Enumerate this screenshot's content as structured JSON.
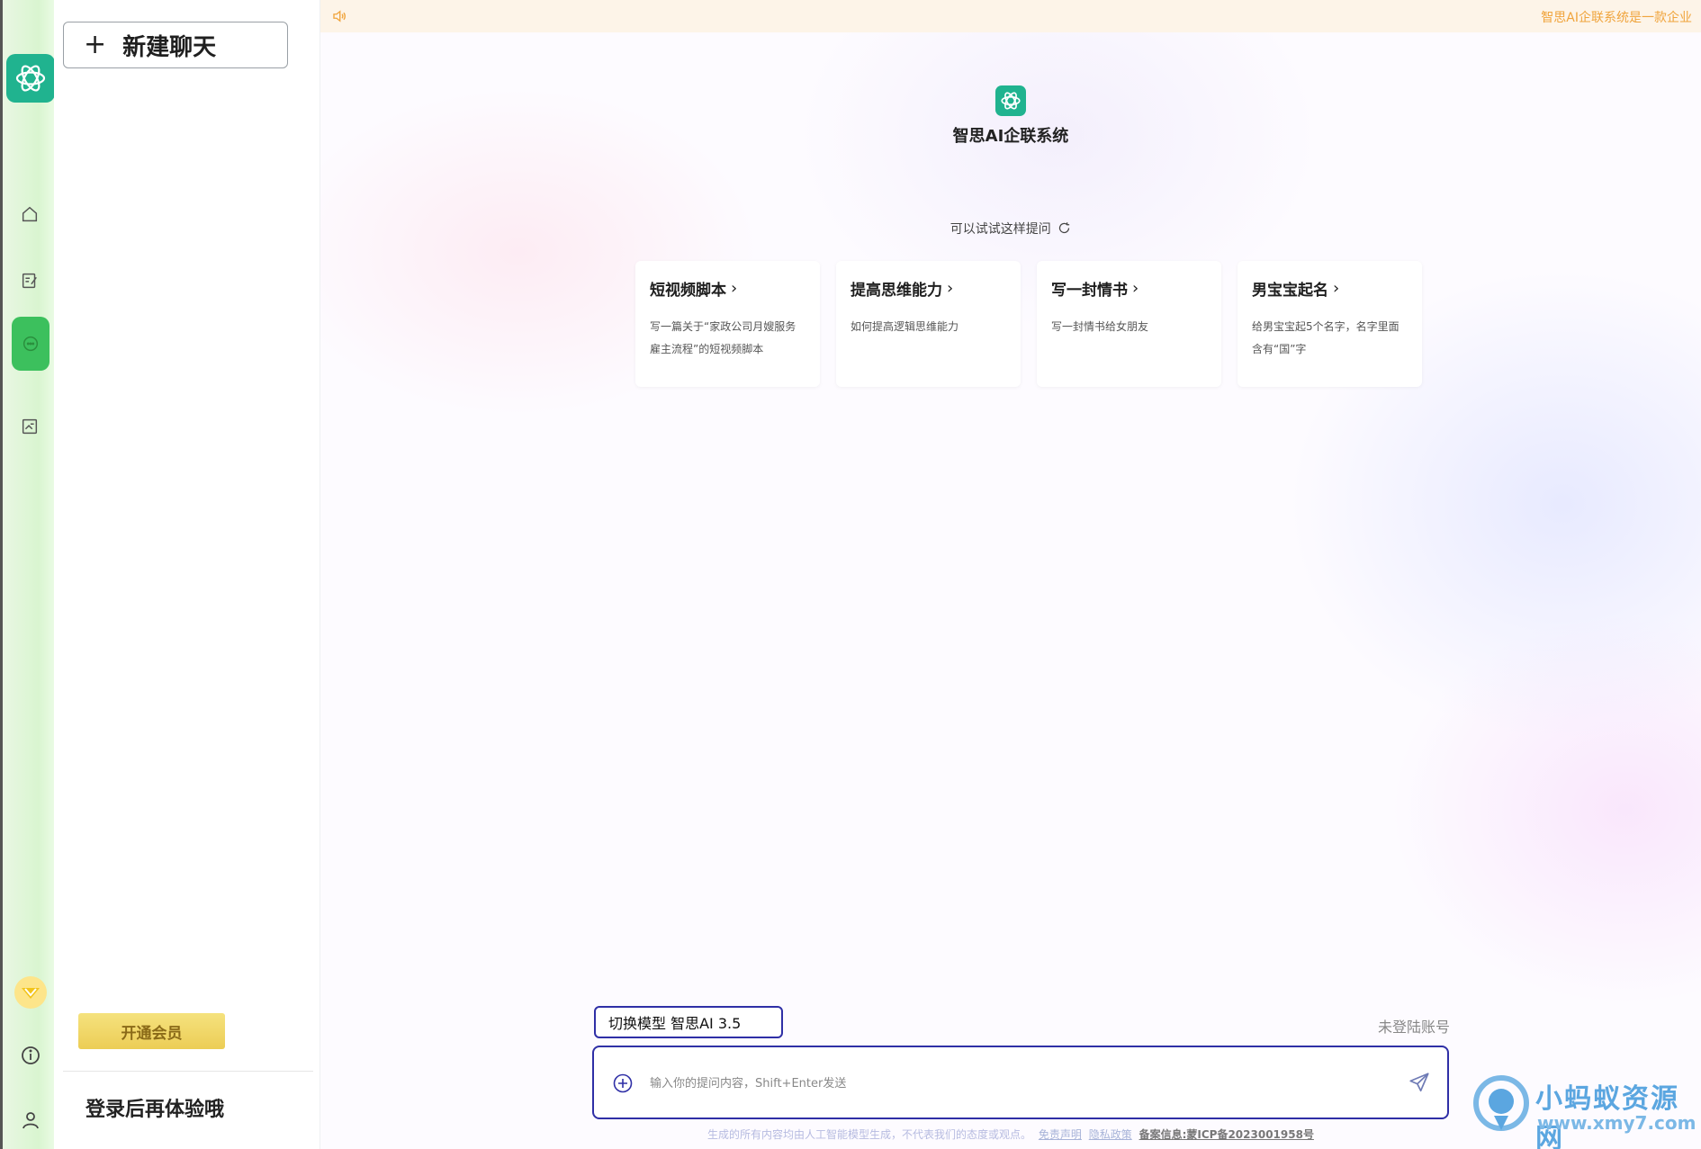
{
  "sidebar": {
    "new_chat_label": "新建聊天",
    "vip_label": "开通会员",
    "login_hint": "登录后再体验哦"
  },
  "rail": {
    "icons": [
      "home-icon",
      "notes-icon",
      "chat-icon",
      "gallery-icon",
      "vip-icon",
      "info-icon",
      "user-icon"
    ],
    "active": "chat-icon",
    "accent_color": "#3cc05d",
    "logo_color": "#20b38f"
  },
  "notice": {
    "text": "智思AI企联系统是一款企业"
  },
  "brand": {
    "title": "智思AI企联系统"
  },
  "suggestions": {
    "heading": "可以试试这样提问",
    "cards": [
      {
        "title": "短视频脚本",
        "desc": "写一篇关于“家政公司月嫂服务雇主流程”的短视频脚本"
      },
      {
        "title": "提高思维能力",
        "desc": "如何提高逻辑思维能力"
      },
      {
        "title": "写一封情书",
        "desc": "写一封情书给女朋友"
      },
      {
        "title": "男宝宝起名",
        "desc": "给男宝宝起5个名字，名字里面含有“国”字"
      }
    ]
  },
  "composer": {
    "model_label": "切换模型 智思AI 3.5",
    "account_status": "未登陆账号",
    "placeholder": "输入你的提问内容，Shift+Enter发送",
    "border_color": "#2f2fa6"
  },
  "footer": {
    "disclaimer": "生成的所有内容均由人工智能模型生成，不代表我们的态度或观点。",
    "disclaimer_link": "免责声明",
    "privacy_link": "隐私政策",
    "icp": "备案信息:蒙ICP备2023001958号"
  },
  "watermark": {
    "cn": "小蚂蚁资源网",
    "url": "www.xmy7.com"
  }
}
